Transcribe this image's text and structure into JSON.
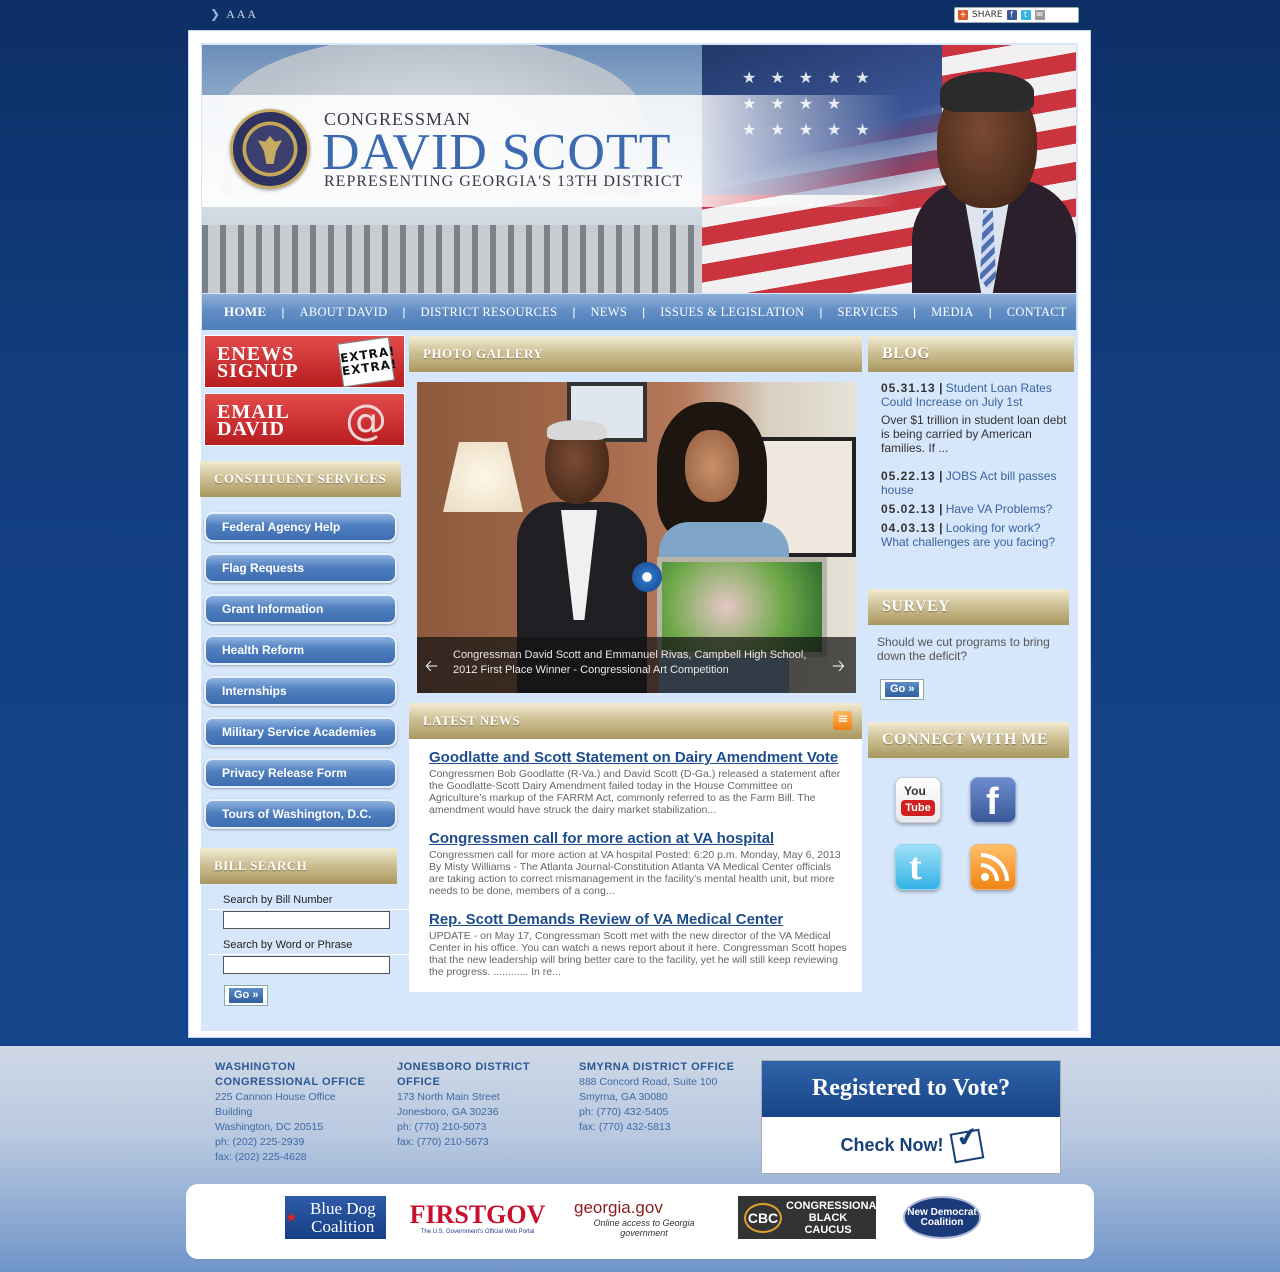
{
  "topbar": {
    "font_sizer": "AAA",
    "share_label": "SHARE"
  },
  "banner": {
    "kicker": "CONGRESSMAN",
    "name": "DAVID SCOTT",
    "subtitle": "REPRESENTING GEORGIA'S 13TH DISTRICT"
  },
  "nav": {
    "items": [
      {
        "label": "HOME"
      },
      {
        "label": "ABOUT DAVID"
      },
      {
        "label": "DISTRICT RESOURCES"
      },
      {
        "label": "NEWS"
      },
      {
        "label": "ISSUES & LEGISLATION"
      },
      {
        "label": "SERVICES"
      },
      {
        "label": "MEDIA"
      },
      {
        "label": "CONTACT"
      }
    ]
  },
  "promos": {
    "enews": {
      "line1": "ENEWS",
      "line2": "SIGNUP",
      "badge": "EXTRA! EXTRA!"
    },
    "email": {
      "line1": "EMAIL",
      "line2": "DAVID",
      "icon": "@"
    }
  },
  "constituent_services": {
    "heading": "CONSTITUENT SERVICES",
    "items": [
      {
        "label": "Federal Agency Help"
      },
      {
        "label": "Flag Requests"
      },
      {
        "label": "Grant Information"
      },
      {
        "label": "Health Reform"
      },
      {
        "label": "Internships"
      },
      {
        "label": "Military Service Academies"
      },
      {
        "label": "Privacy Release Form"
      },
      {
        "label": "Tours of Washington, D.C."
      }
    ]
  },
  "bill_search": {
    "heading": "BILL SEARCH",
    "by_number_label": "Search by Bill Number",
    "by_number_value": "",
    "by_word_label": "Search by Word or Phrase",
    "by_word_value": "",
    "go_label": "Go »"
  },
  "photo_gallery": {
    "heading": "PHOTO GALLERY",
    "caption": "Congressman David Scott and Emmanuel Rivas, Campbell High School, 2012 First Place Winner - Congressional Art Competition"
  },
  "latest_news": {
    "heading": "LATEST NEWS",
    "items": [
      {
        "title": "Goodlatte and Scott Statement on Dairy Amendment Vote",
        "excerpt": "Congressmen Bob Goodlatte (R-Va.) and David Scott (D-Ga.) released a statement after the Goodlatte-Scott Dairy Amendment failed today in the House Committee on Agriculture’s markup of the FARRM Act, commonly referred to as the Farm Bill. The amendment would have struck the dairy market stabilization..."
      },
      {
        "title": "Congressmen call for more action at VA hospital",
        "excerpt": "Congressmen call for more action at VA hospital Posted: 6:20 p.m. Monday, May 6, 2013 By Misty Williams - The Atlanta Journal-Constitution Atlanta VA Medical Center officials are taking action to correct mismanagement in the facility’s mental health unit, but more needs to be done, members of a cong..."
      },
      {
        "title": "Rep. Scott Demands Review of VA Medical Center",
        "excerpt": "UPDATE - on May 17, Congressman Scott met with the new director of the VA Medical Center in his office. You can watch a news report about it here. Congressman Scott hopes that the new leadership will bring better care to the facility, yet he will still keep reviewing the progress. ............ In re..."
      }
    ]
  },
  "blog": {
    "heading": "BLOG",
    "posts": [
      {
        "date": "05.31.13",
        "title": "Student Loan Rates Could Increase on July 1st"
      },
      {
        "date": "05.22.13",
        "title": "JOBS Act bill passes house"
      },
      {
        "date": "05.02.13",
        "title": "Have VA Problems?"
      },
      {
        "date": "04.03.13",
        "title": "Looking for work? What challenges are you facing?"
      }
    ],
    "first_excerpt": "Over $1 trillion in student loan debt is being carried by American families. If ..."
  },
  "survey": {
    "heading": "SURVEY",
    "question": "Should we cut programs to bring down the deficit?",
    "go_label": "Go »"
  },
  "connect": {
    "heading": "CONNECT WITH ME",
    "icons": [
      "youtube-icon",
      "facebook-icon",
      "twitter-icon",
      "rss-icon"
    ],
    "youtube_top": "You",
    "youtube_bottom": "Tube",
    "facebook_glyph": "f",
    "twitter_glyph": "t"
  },
  "footer": {
    "offices": [
      {
        "heading": "WASHINGTON CONGRESSIONAL OFFICE",
        "lines": [
          "225 Cannon House Office Building",
          "Washington, DC 20515",
          "ph: (202) 225-2939",
          "fax: (202) 225-4628"
        ]
      },
      {
        "heading": "JONESBORO DISTRICT OFFICE",
        "lines": [
          "173 North Main Street",
          "Jonesboro, GA 30236",
          "ph: (770) 210-5073",
          "fax: (770) 210-5673"
        ]
      },
      {
        "heading": "SMYRNA DISTRICT OFFICE",
        "lines": [
          "888 Concord Road, Suite 100",
          "Smyrna, GA 30080",
          "ph: (770) 432-5405",
          "fax: (770) 432-5813"
        ]
      }
    ],
    "vote": {
      "heading": "Registered to Vote?",
      "cta": "Check Now!"
    },
    "partners": {
      "bluedog": "Blue Dog Coalition",
      "firstgov_main": "FIRSTGOV",
      "firstgov_sub": "The U.S. Government's Official Web Portal",
      "georgia_main": "georgia.gov",
      "georgia_sub": "Online access to Georgia government",
      "cbc_abbr": "CBC",
      "cbc_name": "CONGRESSIONAL BLACK CAUCUS",
      "ndc": "New Democrat Coalition"
    }
  },
  "colors": {
    "page_bg": "#123d7f",
    "panel_bg": "#d6e6fb",
    "link": "#1d4d8e",
    "gold_header": "#cfc196",
    "promo_red": "#c42428"
  }
}
